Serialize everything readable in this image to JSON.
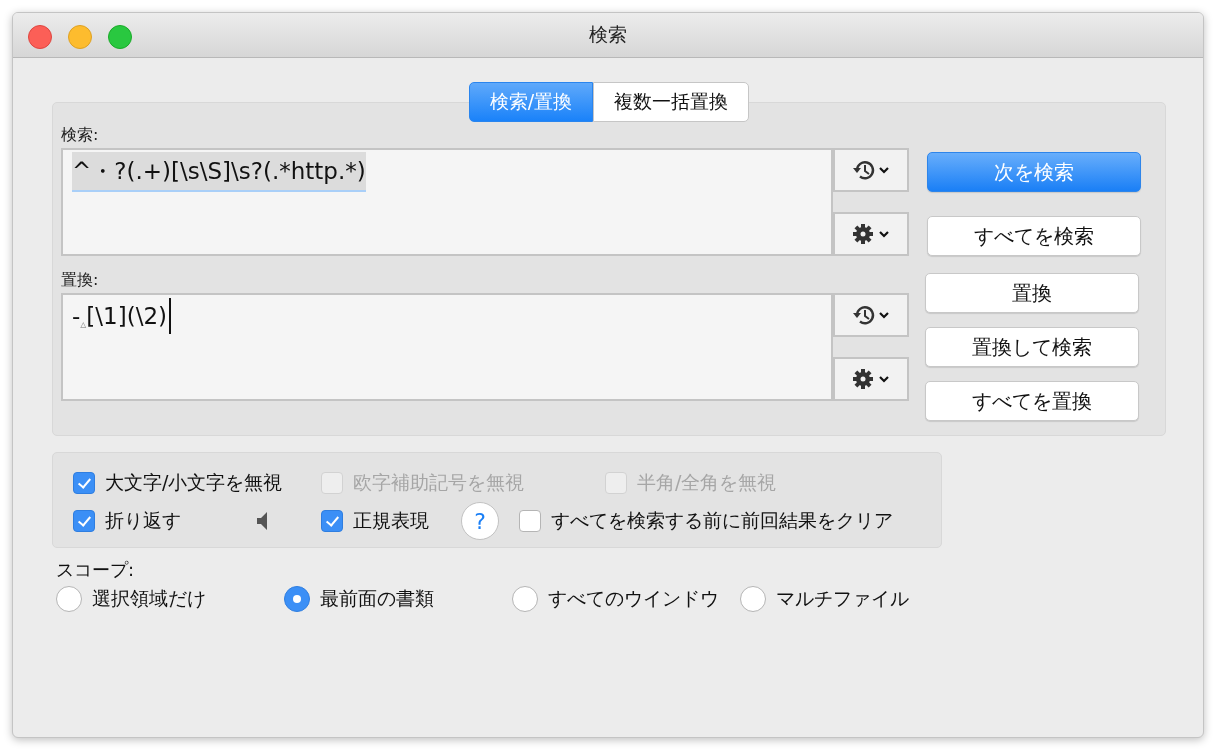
{
  "window": {
    "title": "検索"
  },
  "tabs": [
    {
      "label": "検索/置換",
      "selected": true
    },
    {
      "label": "複数一括置換",
      "selected": false
    }
  ],
  "fields": [
    {
      "label": "検索:",
      "segments": [
        {
          "kind": "text",
          "text": "^・?(.+)[\\s\\S]\\s?(.*http.*)"
        }
      ],
      "selection": true,
      "caret": false
    },
    {
      "label": "置換:",
      "segments": [
        {
          "kind": "text",
          "text": "-"
        },
        {
          "kind": "space-marker",
          "text": "▵"
        },
        {
          "kind": "text",
          "text": "[\\1](\\2)"
        }
      ],
      "selection": false,
      "caret": true
    }
  ],
  "search_buttons": [
    {
      "label": "次を検索",
      "default": true
    },
    {
      "label": "すべてを検索",
      "default": false
    }
  ],
  "replace_buttons": [
    {
      "label": "置換",
      "default": false
    },
    {
      "label": "置換して検索",
      "default": false
    },
    {
      "label": "すべてを置換",
      "default": false
    }
  ],
  "options": [
    [
      {
        "kind": "checkbox",
        "label": "大文字/小文字を無視",
        "checked": true,
        "disabled": false
      },
      {
        "kind": "checkbox",
        "label": "欧字補助記号を無視",
        "checked": false,
        "disabled": true
      },
      {
        "kind": "checkbox",
        "label": "半角/全角を無視",
        "checked": false,
        "disabled": true
      }
    ],
    [
      {
        "kind": "checkbox",
        "label": "折り返す",
        "checked": true,
        "disabled": false
      },
      {
        "kind": "speaker"
      },
      {
        "kind": "checkbox",
        "label": "正規表現",
        "checked": true,
        "disabled": false
      },
      {
        "kind": "help",
        "label": "?"
      },
      {
        "kind": "checkbox",
        "label": "すべてを検索する前に前回結果をクリア",
        "checked": false,
        "disabled": false
      }
    ]
  ],
  "scope": {
    "label": "スコープ:",
    "options": [
      {
        "label": "選択領域だけ",
        "selected": false
      },
      {
        "label": "最前面の書類",
        "selected": true
      },
      {
        "label": "すべてのウインドウ",
        "selected": false
      },
      {
        "label": "マルチファイル",
        "selected": false
      }
    ]
  }
}
